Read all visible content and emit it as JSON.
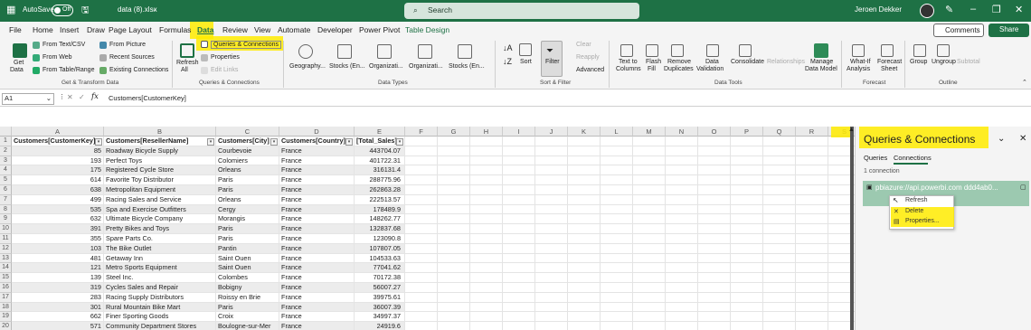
{
  "titlebar": {
    "autosave": "AutoSave",
    "toggle": "Off",
    "filename": "data (8).xlsx",
    "search": "Search",
    "user": "Jeroen Dekker"
  },
  "menu": [
    "File",
    "Home",
    "Insert",
    "Draw",
    "Page Layout",
    "Formulas",
    "Data",
    "Review",
    "View",
    "Automate",
    "Developer",
    "Power Pivot",
    "Table Design"
  ],
  "menu_active": "Data",
  "comments": "Comments",
  "share": "Share",
  "ribbon": {
    "get_data": [
      "Get",
      "Data"
    ],
    "from_text": "From Text/CSV",
    "from_web": "From Web",
    "from_table": "From Table/Range",
    "from_picture": "From Picture",
    "recent_sources": "Recent Sources",
    "existing_connections": "Existing Connections",
    "group_get": "Get & Transform Data",
    "refresh_all": [
      "Refresh",
      "All"
    ],
    "queries_connections": "Queries & Connections",
    "properties": "Properties",
    "edit_links": "Edit Links",
    "group_queries": "Queries & Connections",
    "data_types": [
      "Geography...",
      "Stocks (En...",
      "Organizati...",
      "Organizati...",
      "Stocks (En..."
    ],
    "group_data_types": "Data Types",
    "sort": "Sort",
    "filter": "Filter",
    "clear": "Clear",
    "reapply": "Reapply",
    "advanced": "Advanced",
    "group_sort": "Sort & Filter",
    "text_to_columns": [
      "Text to",
      "Columns"
    ],
    "flash_fill": [
      "Flash",
      "Fill"
    ],
    "remove_duplicates": [
      "Remove",
      "Duplicates"
    ],
    "data_validation": [
      "Data",
      "Validation"
    ],
    "consolidate": "Consolidate",
    "relationships": "Relationships",
    "manage_data_model": [
      "Manage",
      "Data Model"
    ],
    "group_data_tools": "Data Tools",
    "what_if": [
      "What-If",
      "Analysis"
    ],
    "forecast_sheet": [
      "Forecast",
      "Sheet"
    ],
    "group_forecast": "Forecast",
    "group_btn": "Group",
    "ungroup": "Ungroup",
    "subtotal": "Subtotal",
    "group_outline": "Outline"
  },
  "formula": {
    "namebox": "A1",
    "content": "Customers[CustomerKey]",
    "fx": "fx"
  },
  "columns": [
    "A",
    "B",
    "C",
    "D",
    "E",
    "F",
    "G",
    "H",
    "I",
    "J",
    "K",
    "L",
    "M",
    "N",
    "O",
    "P",
    "Q",
    "R",
    "S"
  ],
  "headers": [
    "Customers[CustomerKey]",
    "Customers[ResellerName]",
    "Customers[City]",
    "Customers[Country]",
    "[Total_Sales]"
  ],
  "rows": [
    [
      "85",
      "Roadway Bicycle Supply",
      "Courbevoie",
      "France",
      "443704.07"
    ],
    [
      "193",
      "Perfect Toys",
      "Colomiers",
      "France",
      "401722.31"
    ],
    [
      "175",
      "Registered Cycle Store",
      "Orleans",
      "France",
      "316131.4"
    ],
    [
      "614",
      "Favorite Toy Distributor",
      "Paris",
      "France",
      "288775.96"
    ],
    [
      "638",
      "Metropolitan Equipment",
      "Paris",
      "France",
      "262863.28"
    ],
    [
      "499",
      "Racing Sales and Service",
      "Orleans",
      "France",
      "222513.57"
    ],
    [
      "535",
      "Spa and Exercise Outfitters",
      "Cergy",
      "France",
      "178489.9"
    ],
    [
      "632",
      "Ultimate Bicycle Company",
      "Morangis",
      "France",
      "148262.77"
    ],
    [
      "391",
      "Pretty Bikes and Toys",
      "Paris",
      "France",
      "132837.68"
    ],
    [
      "355",
      "Spare Parts Co.",
      "Paris",
      "France",
      "123090.8"
    ],
    [
      "103",
      "The Bike Outlet",
      "Pantin",
      "France",
      "107807.05"
    ],
    [
      "481",
      "Getaway Inn",
      "Saint Ouen",
      "France",
      "104533.63"
    ],
    [
      "121",
      "Metro Sports Equipment",
      "Saint Ouen",
      "France",
      "77041.62"
    ],
    [
      "139",
      "Steel Inc.",
      "Colombes",
      "France",
      "70172.38"
    ],
    [
      "319",
      "Cycles Sales and Repair",
      "Bobigny",
      "France",
      "56007.27"
    ],
    [
      "283",
      "Racing Supply Distributors",
      "Roissy en Brie",
      "France",
      "39975.61"
    ],
    [
      "301",
      "Rural Mountain Bike Mart",
      "Paris",
      "France",
      "36007.39"
    ],
    [
      "662",
      "Finer Sporting Goods",
      "Croix",
      "France",
      "34997.37"
    ],
    [
      "571",
      "Community Department Stores",
      "Boulogne-sur-Mer",
      "France",
      "24919.6"
    ]
  ],
  "pane": {
    "title": "Queries & Connections",
    "tab_queries": "Queries",
    "tab_connections": "Connections",
    "count": "1 connection",
    "connection": "pbiazure://api.powerbi.com ddd4ab0...",
    "ctx": [
      "Refresh",
      "Delete",
      "Properties..."
    ]
  },
  "colors": {
    "excel_green": "#1e7145",
    "highlight": "#ffeb00",
    "connection_bg": "#9cc9b0"
  }
}
